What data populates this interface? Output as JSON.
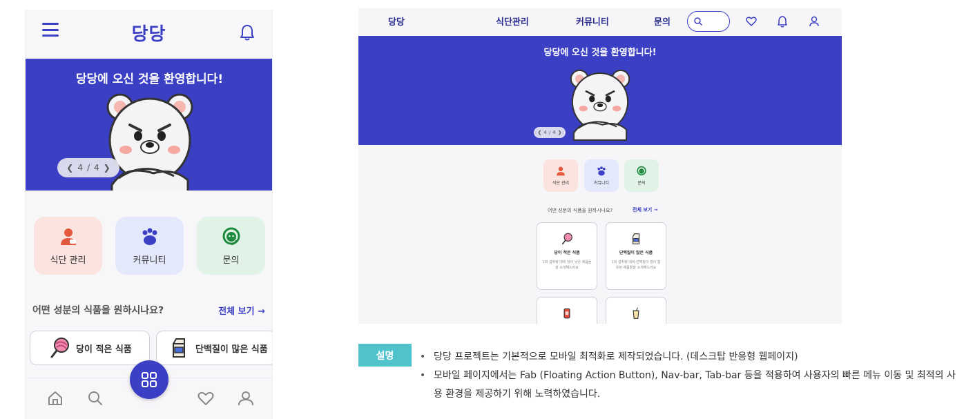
{
  "colors": {
    "primary": "#3b3fc4",
    "accent": "#4fc2cb",
    "pink_tile": "#fbe3e0",
    "blue_tile": "#e4e8fb",
    "green_tile": "#e1f3e6"
  },
  "mobile": {
    "logo": "당당",
    "banner_title": "당당에 오신 것을 환영합니다!",
    "pager": {
      "current": "4",
      "sep": "/",
      "total": "4"
    },
    "quick_menu": [
      {
        "label": "식단 관리",
        "icon": "user-diet-icon"
      },
      {
        "label": "커뮤니티",
        "icon": "paw-community-icon"
      },
      {
        "label": "문의",
        "icon": "support-agent-icon"
      }
    ],
    "section_question": "어떤 성분의 식품을 원하시나요?",
    "section_link": "전체 보기 →",
    "cards": [
      {
        "label": "당이 적은 식품",
        "icon": "lollipop-icon"
      },
      {
        "label": "단백질이 많은 식품",
        "icon": "milk-carton-icon"
      }
    ],
    "tabbar": [
      "home-icon",
      "search-icon",
      "grid-fab-icon",
      "heart-icon",
      "user-icon"
    ]
  },
  "desktop": {
    "nav": {
      "logo": "당당",
      "diet": "식단관리",
      "community": "커뮤니티",
      "inquiry": "문의"
    },
    "banner_title": "당당에 오신 것을 환영합니다!",
    "pager": {
      "current": "4",
      "sep": "/",
      "total": "4"
    },
    "quick_menu": [
      {
        "label": "식단 관리"
      },
      {
        "label": "커뮤니티"
      },
      {
        "label": "문의"
      }
    ],
    "section_question": "어떤 성분의 식품을 원하시나요?",
    "section_link": "전체 보기 →",
    "cards": [
      {
        "title": "당이 적은 식품",
        "desc": "1회 섭취량 대비 당이 낮은 제품들을 소개해드려요"
      },
      {
        "title": "단백질이 많은 식품",
        "desc": "1회 섭취량 대비 단백질이 많이 함유된 제품들을 소개해드려요"
      }
    ]
  },
  "description": {
    "badge": "설명",
    "items": [
      "당당 프로젝트는 기본적으로 모바일 최적화로 제작되었습니다. (데스크탑 반응형 웹페이지)",
      "모바일 페이지에서는 Fab (Floating Action Button), Nav-bar, Tab-bar 등을 적용하여 사용자의 빠른 메뉴 이동 및 최적의 사용 환경을 제공하기 위해 노력하였습니다."
    ]
  }
}
